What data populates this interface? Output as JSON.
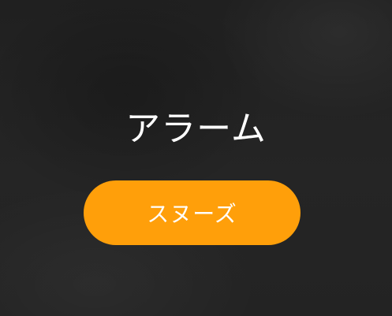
{
  "alarm": {
    "title": "アラーム",
    "snooze_label": "スヌーズ",
    "accent_color": "#ff9f0a",
    "background_color": "#232323"
  }
}
